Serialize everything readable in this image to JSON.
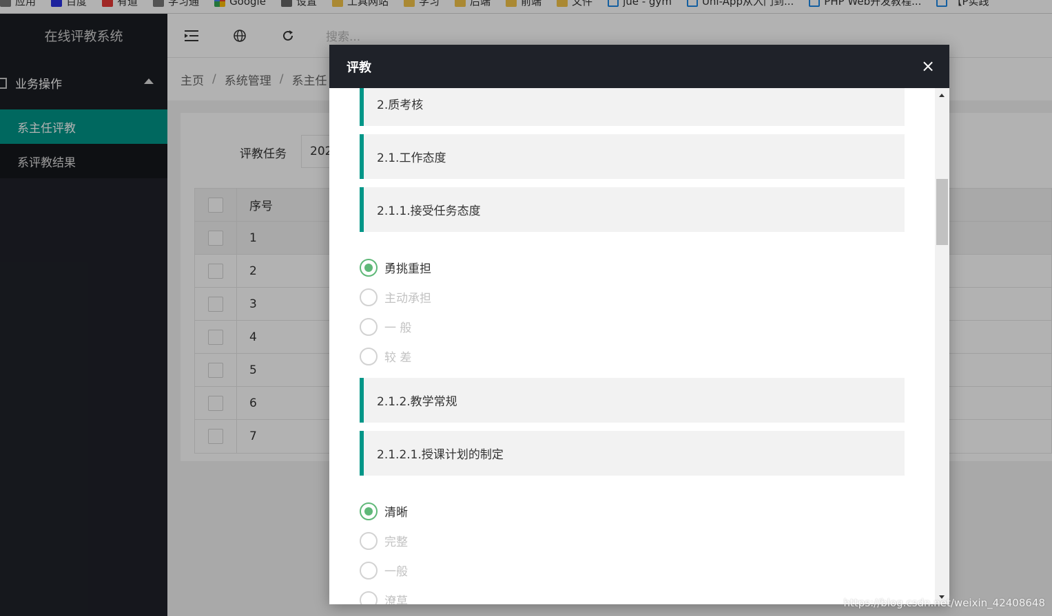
{
  "bookmarks": [
    {
      "label": "应用",
      "icon": "apps-icon"
    },
    {
      "label": "百度",
      "icon": "baidu-icon"
    },
    {
      "label": "有道",
      "icon": "red-icon"
    },
    {
      "label": "学习通",
      "icon": "grey-icon"
    },
    {
      "label": "Google",
      "icon": "google-icon"
    },
    {
      "label": "设置",
      "icon": "gear-icon"
    },
    {
      "label": "工具网站",
      "icon": "folder-icon"
    },
    {
      "label": "学习",
      "icon": "folder-icon"
    },
    {
      "label": "后端",
      "icon": "folder-icon"
    },
    {
      "label": "前端",
      "icon": "folder-icon"
    },
    {
      "label": "文件",
      "icon": "folder-icon"
    },
    {
      "label": "jue - gym",
      "icon": "page-icon"
    },
    {
      "label": "Uni-App从入门到...",
      "icon": "page-icon"
    },
    {
      "label": "PHP Web开发教程...",
      "icon": "page-icon"
    },
    {
      "label": "【P实践",
      "icon": "page-icon"
    }
  ],
  "sidebar": {
    "logo": "在线评教系统",
    "group_label": "业务操作",
    "items": [
      {
        "label": "系主任评教",
        "active": true
      },
      {
        "label": "系评教结果",
        "active": false
      }
    ]
  },
  "header": {
    "search_placeholder": "搜索..."
  },
  "breadcrumb": [
    "主页",
    "系统管理",
    "系主任"
  ],
  "content": {
    "task_label": "评教任务",
    "task_value": "202",
    "table_header": "序号",
    "rows": [
      "1",
      "2",
      "3",
      "4",
      "5",
      "6",
      "7"
    ]
  },
  "modal": {
    "title": "评教",
    "close_label": "×",
    "sections": [
      {
        "type": "heading",
        "text": "2.质考核"
      },
      {
        "type": "heading",
        "text": "2.1.工作态度"
      },
      {
        "type": "heading",
        "text": "2.1.1.接受任务态度"
      },
      {
        "type": "options",
        "items": [
          {
            "label": "勇挑重担",
            "checked": true
          },
          {
            "label": "主动承担",
            "checked": false
          },
          {
            "label": "一 般",
            "checked": false
          },
          {
            "label": "较 差",
            "checked": false
          }
        ]
      },
      {
        "type": "heading",
        "text": "2.1.2.教学常规"
      },
      {
        "type": "heading",
        "text": "2.1.2.1.授课计划的制定"
      },
      {
        "type": "options",
        "items": [
          {
            "label": "清晰",
            "checked": true
          },
          {
            "label": "完整",
            "checked": false
          },
          {
            "label": "一般",
            "checked": false
          },
          {
            "label": "潦草",
            "checked": false
          }
        ]
      }
    ]
  },
  "watermark": "https://blog.csdn.net/weixin_42408648",
  "colors": {
    "accent": "#009688",
    "radio_checked": "#5fb878",
    "sidebar_bg": "#20222a",
    "modal_header_bg": "#1f2229"
  }
}
